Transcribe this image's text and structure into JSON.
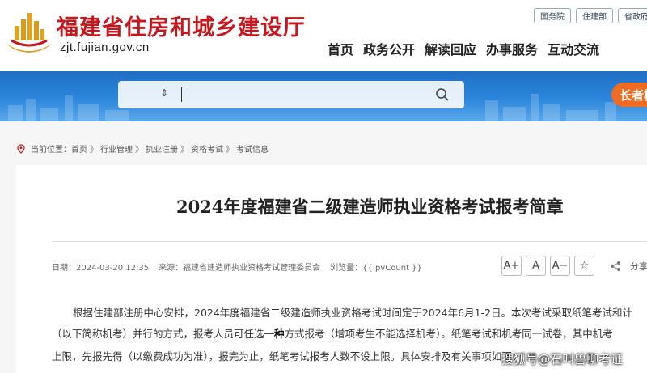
{
  "header": {
    "site_title": "福建省住房和城乡建设厅",
    "site_url": "zjt.fujian.gov.cn",
    "top_links": [
      "国务院",
      "住建部",
      "省政府"
    ],
    "nav": [
      "首页",
      "政务公开",
      "解读回应",
      "办事服务",
      "互动交流"
    ]
  },
  "search": {
    "sort_symbol": "⇕",
    "placeholder": ""
  },
  "elder_mode": {
    "label": "长者模"
  },
  "breadcrumb": {
    "prefix": "当前位置：",
    "items": [
      "首页",
      "行业管理",
      "执业注册",
      "资格考试",
      "考试信息"
    ],
    "separator": "》"
  },
  "article": {
    "title": "2024年度福建省二级建造师执业资格考试报考简章",
    "meta": {
      "date": "日期：2024-03-20 12:35",
      "source": "来源：福建省建造师执业资格考试管理委员会",
      "views": "浏览量：{{ pvCount }}"
    },
    "tools": {
      "font_up": "A+",
      "font_normal": "A",
      "font_down": "A−",
      "favorite": "☆",
      "share_label": "分享:"
    },
    "paragraphs": {
      "line1": "根据住建部注册中心安排，2024年度福建省二级建造师执业资格考试时间定于2024年6月1-2日。本次考试采取纸笔考试和计",
      "line2a": "（以下简称机考）并行的方式，报考人员可任选",
      "line2b": "一种",
      "line2c": "方式报考（增项考生不能选择机考）。纸笔考试和机考同一试卷，其中机考",
      "line3": "上限，先报先得（以缴费成功为准），报完为止，纸笔考试报考人数不设上限。具体安排及有关事项如下："
    }
  },
  "watermark": "搜狐号@石叫兽聊考证",
  "colors": {
    "title_red": "#c8161d",
    "banner_blue": "#2c86dc",
    "elder_orange": "#f26b22"
  }
}
